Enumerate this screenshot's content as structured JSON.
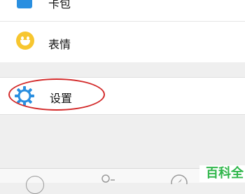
{
  "menu": {
    "items": [
      {
        "label": "卡包",
        "icon": "card-wallet-icon"
      },
      {
        "label": "表情",
        "icon": "emoji-icon"
      },
      {
        "label": "设置",
        "icon": "gear-icon"
      }
    ]
  },
  "tabbar": {
    "icons": [
      "chat-bubble-icon",
      "contacts-icon",
      "discover-compass-icon"
    ]
  },
  "watermark": {
    "text": "百科全"
  },
  "colors": {
    "accent_blue": "#2a8fe0",
    "emoji_yellow": "#f7c62f",
    "highlight_red": "#d32a2a",
    "watermark_green": "#2fb64a"
  }
}
